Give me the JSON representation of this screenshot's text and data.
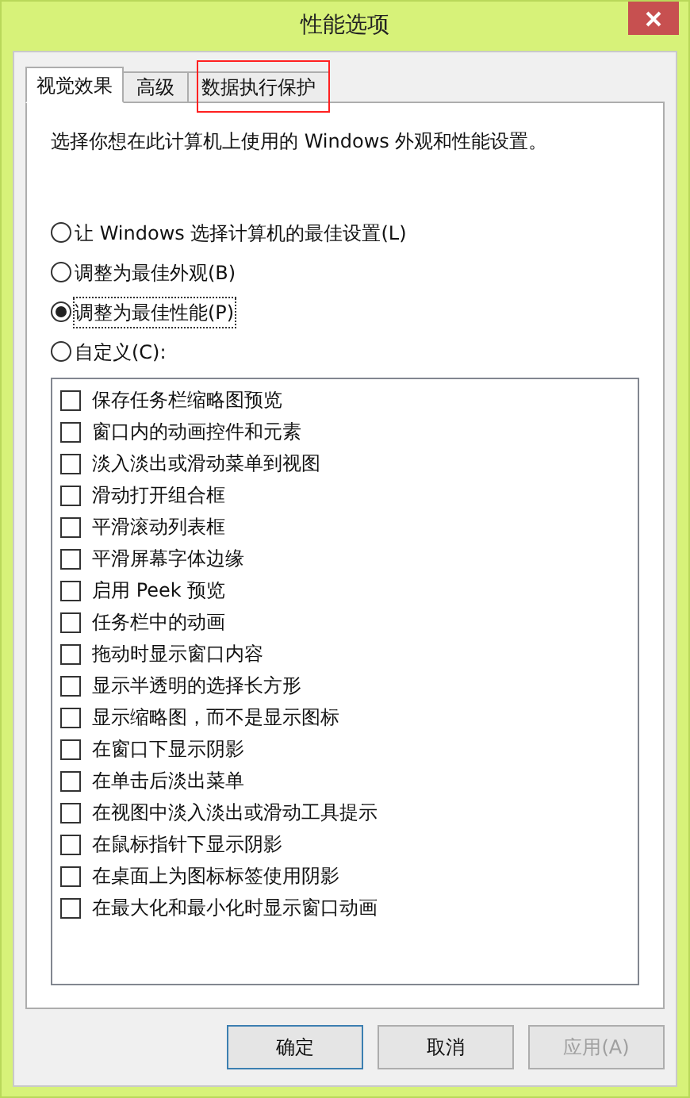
{
  "window": {
    "title": "性能选项"
  },
  "tabs": [
    {
      "label": "视觉效果",
      "selected": true
    },
    {
      "label": "高级",
      "selected": false
    },
    {
      "label": "数据执行保护",
      "selected": false
    }
  ],
  "description": "选择你想在此计算机上使用的 Windows 外观和性能设置。",
  "radios": [
    {
      "label": "让 Windows 选择计算机的最佳设置(L)",
      "selected": false
    },
    {
      "label": "调整为最佳外观(B)",
      "selected": false
    },
    {
      "label": "调整为最佳性能(P)",
      "selected": true
    },
    {
      "label": "自定义(C):",
      "selected": false
    }
  ],
  "options": [
    {
      "label": "保存任务栏缩略图预览",
      "checked": false
    },
    {
      "label": "窗口内的动画控件和元素",
      "checked": false
    },
    {
      "label": "淡入淡出或滑动菜单到视图",
      "checked": false
    },
    {
      "label": "滑动打开组合框",
      "checked": false
    },
    {
      "label": "平滑滚动列表框",
      "checked": false
    },
    {
      "label": "平滑屏幕字体边缘",
      "checked": false
    },
    {
      "label": "启用 Peek 预览",
      "checked": false
    },
    {
      "label": "任务栏中的动画",
      "checked": false
    },
    {
      "label": "拖动时显示窗口内容",
      "checked": false
    },
    {
      "label": "显示半透明的选择长方形",
      "checked": false
    },
    {
      "label": "显示缩略图，而不是显示图标",
      "checked": false
    },
    {
      "label": "在窗口下显示阴影",
      "checked": false
    },
    {
      "label": "在单击后淡出菜单",
      "checked": false
    },
    {
      "label": "在视图中淡入淡出或滑动工具提示",
      "checked": false
    },
    {
      "label": "在鼠标指针下显示阴影",
      "checked": false
    },
    {
      "label": "在桌面上为图标标签使用阴影",
      "checked": false
    },
    {
      "label": "在最大化和最小化时显示窗口动画",
      "checked": false
    }
  ],
  "buttons": [
    {
      "label": "确定",
      "kind": "default",
      "disabled": false
    },
    {
      "label": "取消",
      "kind": "normal",
      "disabled": false
    },
    {
      "label": "应用(A)",
      "kind": "normal",
      "disabled": true
    }
  ]
}
